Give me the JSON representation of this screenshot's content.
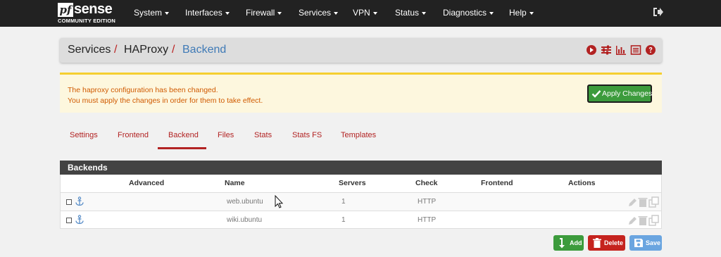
{
  "brand": {
    "logo_pf": "pf",
    "logo_name": "sense",
    "edition": "COMMUNITY EDITION"
  },
  "nav": {
    "items": [
      {
        "label": "System"
      },
      {
        "label": "Interfaces"
      },
      {
        "label": "Firewall"
      },
      {
        "label": "Services"
      },
      {
        "label": "VPN"
      },
      {
        "label": "Status"
      },
      {
        "label": "Diagnostics"
      },
      {
        "label": "Help"
      }
    ],
    "logout_icon": "sign-out-icon"
  },
  "breadcrumb": {
    "items": [
      "Services",
      "HAProxy",
      "Backend"
    ],
    "separator": "/",
    "icons": [
      "play-circle-icon",
      "sliders-icon",
      "bar-chart-icon",
      "list-icon",
      "question-circle-icon"
    ]
  },
  "alert": {
    "line1": "The haproxy configuration has been changed.",
    "line2": "You must apply the changes in order for them to take effect.",
    "apply_label": "Apply Changes"
  },
  "tabs": {
    "items": [
      "Settings",
      "Frontend",
      "Backend",
      "Files",
      "Stats",
      "Stats FS",
      "Templates"
    ],
    "active": "Backend"
  },
  "table": {
    "title": "Backends",
    "columns": [
      "Advanced",
      "Name",
      "Servers",
      "Check",
      "Frontend",
      "Actions"
    ],
    "rows": [
      {
        "name": "web.ubuntu",
        "servers": "1",
        "check": "HTTP",
        "frontend": ""
      },
      {
        "name": "wiki.ubuntu",
        "servers": "1",
        "check": "HTTP",
        "frontend": ""
      }
    ]
  },
  "buttons": {
    "add": "Add",
    "delete": "Delete",
    "save": "Save"
  },
  "colors": {
    "navbar": "#222222",
    "link_red": "#b22222",
    "crumb_blue": "#3f7ab6",
    "alert_bg": "#fdf7de",
    "alert_border": "#f5cf30",
    "alert_text": "#d05a00",
    "success": "#3c9b3c",
    "danger": "#c5231e",
    "primary": "#6aa5e0"
  }
}
